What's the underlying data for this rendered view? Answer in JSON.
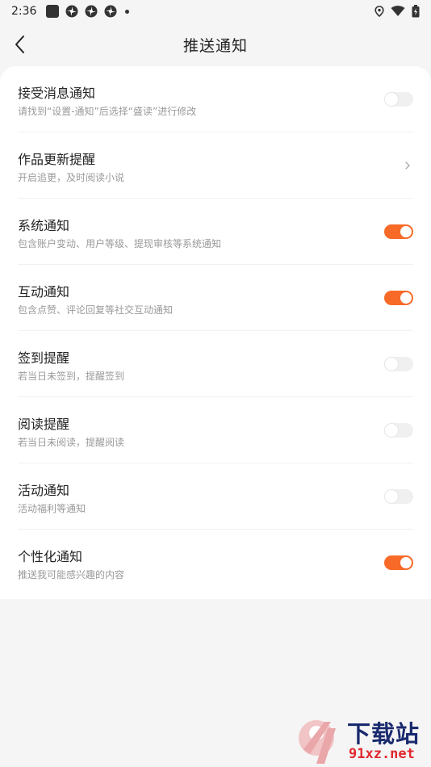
{
  "status_bar": {
    "time": "2:36"
  },
  "header": {
    "title": "推送通知"
  },
  "settings": [
    {
      "title": "接受消息通知",
      "subtitle": "请找到“设置-通知”后选择“盛读”进行修改",
      "control": "toggle",
      "on": false
    },
    {
      "title": "作品更新提醒",
      "subtitle": "开启追更，及时阅读小说",
      "control": "chevron"
    },
    {
      "title": "系统通知",
      "subtitle": "包含账户变动、用户等级、提现审核等系统通知",
      "control": "toggle",
      "on": true
    },
    {
      "title": "互动通知",
      "subtitle": "包含点赞、评论回复等社交互动通知",
      "control": "toggle",
      "on": true
    },
    {
      "title": "签到提醒",
      "subtitle": "若当日未签到，提醒签到",
      "control": "toggle",
      "on": false
    },
    {
      "title": "阅读提醒",
      "subtitle": "若当日未阅读，提醒阅读",
      "control": "toggle",
      "on": false
    },
    {
      "title": "活动通知",
      "subtitle": "活动福利等通知",
      "control": "toggle",
      "on": false
    },
    {
      "title": "个性化通知",
      "subtitle": "推送我可能感兴趣的内容",
      "control": "toggle",
      "on": true
    }
  ],
  "colors": {
    "accent": "#f86a27",
    "toggle_off": "#f0f0f0"
  },
  "watermark": {
    "title": "下载站",
    "url": "91xz.net"
  }
}
